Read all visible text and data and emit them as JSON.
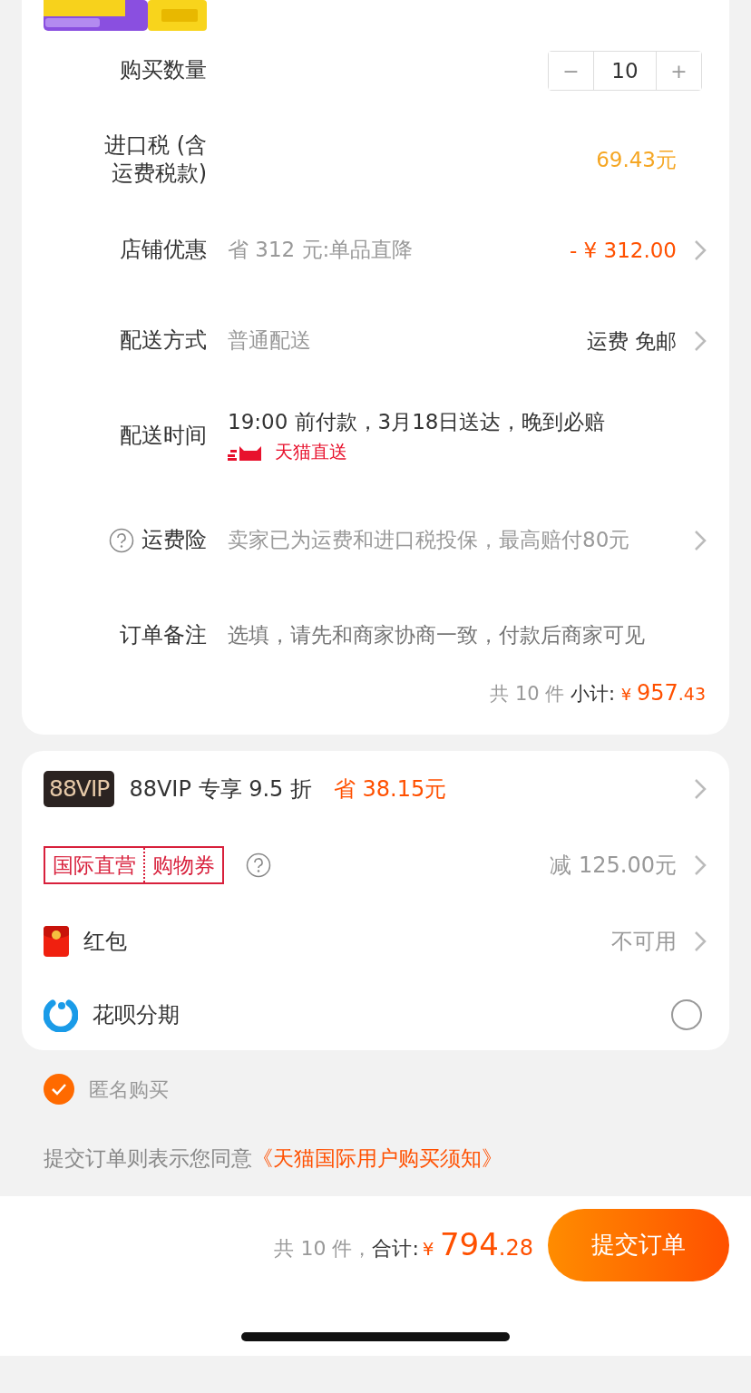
{
  "order_rows": [
    {
      "kind": "quantity",
      "label": "购买数量",
      "minus": "−",
      "quantity": "10",
      "plus": "+"
    },
    {
      "kind": "value",
      "label": "进口税 (含运费税款)",
      "value": "69.43元",
      "color": "#f5a623",
      "arrow": false
    },
    {
      "kind": "value",
      "label": "店铺优惠",
      "detail": "省 312 元:单品直降",
      "value": "- ¥ 312.00",
      "color": "#ff5000",
      "arrow": true
    },
    {
      "kind": "value",
      "label": "配送方式",
      "detail": "普通配送",
      "value": "运费 免邮",
      "color": "#333333",
      "arrow": true
    },
    {
      "kind": "delivery",
      "label": "配送时间",
      "detail": "19:00 前付款，3月18日送达，晚到必赔",
      "service": "天猫直送"
    },
    {
      "kind": "insurance",
      "label": "运费险",
      "detail": "卖家已为运费和进口税投保，最高赔付80元",
      "arrow": true
    },
    {
      "kind": "note",
      "label": "订单备注",
      "placeholder": "选填，请先和商家协商一致，付款后商家可见"
    }
  ],
  "subtotal": {
    "count": "共 10 件",
    "label": "小计:",
    "currency": "¥",
    "integer": "957",
    "decimal": ".43"
  },
  "benefit_rows": [
    {
      "kind": "vip",
      "badge": "88VIP",
      "label": "88VIP 专享 9.5 折",
      "saving": "省 38.15元"
    },
    {
      "kind": "coupon",
      "tag_left": "国际直营",
      "tag_right": "购物券",
      "value": "减 125.00元"
    },
    {
      "kind": "redpacket",
      "label": "红包",
      "value": "不可用"
    },
    {
      "kind": "huabei",
      "label": "花呗分期",
      "selected": false
    }
  ],
  "anonymous": {
    "label": "匿名购买",
    "checked": true
  },
  "agreement": {
    "text": "提交订单则表示您同意",
    "link": "《天猫国际用户购买须知》"
  },
  "footer": {
    "count": "共 10 件，",
    "label": "合计:",
    "currency": "¥",
    "integer": "794",
    "decimal": ".28",
    "submit": "提交订单"
  }
}
